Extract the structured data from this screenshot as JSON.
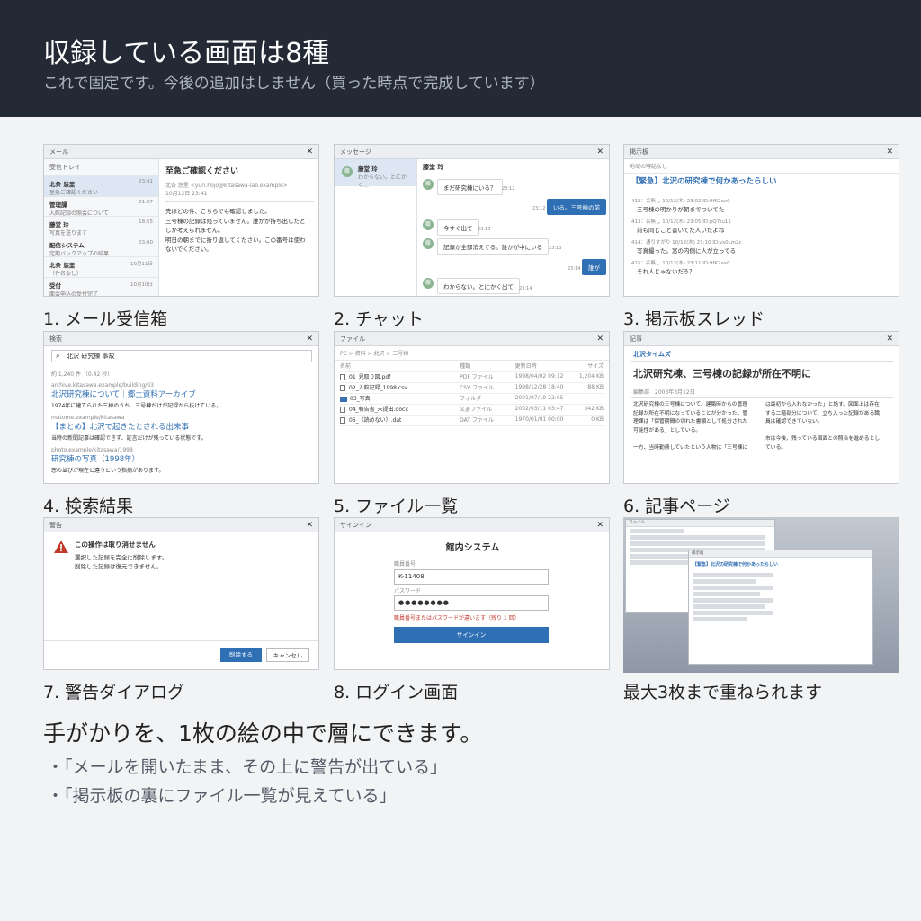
{
  "header": {
    "title": "収録している画面は8種",
    "subtitle": "これで固定です。今後の追加はしません（買った時点で完成しています）"
  },
  "captions": [
    "1. メール受信箱",
    "2. チャット",
    "3. 掲示板スレッド",
    "4. 検索結果",
    "5. ファイル一覧",
    "6. 記事ページ",
    "7. 警告ダイアログ",
    "8. ログイン画面",
    "最大3枚まで重ねられます"
  ],
  "mail": {
    "title": "メール",
    "folder": "受信トレイ",
    "items": [
      {
        "from": "北条 悠里",
        "subject": "至急ご確認ください",
        "time": "23:41"
      },
      {
        "from": "管理課",
        "subject": "入館記録の照会について",
        "time": "21:07"
      },
      {
        "from": "藤堂 玲",
        "subject": "写真を送ります",
        "time": "18:55"
      },
      {
        "from": "配信システム",
        "subject": "定期バックアップの結果",
        "time": "03:00"
      },
      {
        "from": "北条 悠里",
        "subject": "（件名なし）",
        "time": "10月11日"
      },
      {
        "from": "受付",
        "subject": "面会申込の受付完了",
        "time": "10月10日"
      }
    ],
    "open_subject": "至急ご確認ください",
    "open_from": "北条 悠里 <yuri.hojo@kitasawa-lab.example>",
    "open_date": "10月12日 23:41",
    "body": [
      "先ほどの件、こちらでも確認しました。",
      "三号棟の記録は残っていません。誰かが持ち出したと",
      "しか考えられません。",
      "明日の朝までに折り返してください。この番号は使わ",
      "ないでください。"
    ]
  },
  "chat": {
    "title": "メッセージ",
    "contact": "藤堂 玲",
    "preview": "わからない。とにかく…",
    "avatar": "藤",
    "messages": [
      {
        "text": "まだ研究棟にいる？",
        "time": "23:12"
      },
      {
        "text": "いる。三号棟の前",
        "time": "23:12"
      },
      {
        "text": "今すぐ出て",
        "time": "23:13"
      },
      {
        "text": "記録が全部消えてる。誰かが中にいる",
        "time": "23:13"
      },
      {
        "text": "誰が",
        "time": "23:14"
      },
      {
        "text": "わからない。とにかく出て",
        "time": "23:14"
      }
    ]
  },
  "board": {
    "title": "掲示板",
    "sub": "地域の噂話なし",
    "thread": "【緊急】北沢の研究棟で何かあったらしい",
    "posts": [
      {
        "meta": "412：名無し 10/12(木) 23:02 ID:9fK2ax0",
        "text": "三号棟の明かりが朝までついてた"
      },
      {
        "meta": "413：名無し 10/12(木) 23:05 ID:pQ7tu11",
        "text": "前も同じこと書いてた人いたよね"
      },
      {
        "meta": "414：通りすがり 10/12(木) 23:10 ID:vs0Lm2c",
        "text": "写真撮った。窓の内側に人が立ってる"
      },
      {
        "meta": "415：名無し 10/12(木) 23:11 ID:9fK2ax0",
        "text": "それ人じゃないだろ？"
      }
    ]
  },
  "search": {
    "title": "検索",
    "query": "北沢 研究棟 事故",
    "count": "約 1,240 件 （0.42 秒）",
    "results": [
      {
        "url": "archive.kitasawa.example/building/03",
        "title": "北沢研究棟について｜郷土資料アーカイブ",
        "snippet": "1974年に建てられた三棟のうち、三号棟だけが記録から抜けている。"
      },
      {
        "url": "matome.example/kitasawa",
        "title": "【まとめ】北沢で起きたとされる出来事",
        "snippet": "当時の新聞記事は確認できず、証言だけが残っている状態です。"
      },
      {
        "url": "photo.example/kitasawa/1998",
        "title": "研究棟の写真（1998年）",
        "snippet": "窓の並びが現在と違うという指摘があります。"
      }
    ]
  },
  "files": {
    "title": "ファイル",
    "path": "PC > 資料 > 北沢 > 三号棟",
    "cols": [
      "名前",
      "種類",
      "更新日時",
      "サイズ"
    ],
    "rows": [
      {
        "name": "01_見取り図.pdf",
        "type": "PDF ファイル",
        "date": "1998/04/02 09:12",
        "size": "1,204 KB",
        "folder": false
      },
      {
        "name": "02_入館記録_1998.csv",
        "type": "CSV ファイル",
        "date": "1998/12/28 18:40",
        "size": "88 KB",
        "folder": false
      },
      {
        "name": "03_写真",
        "type": "フォルダー",
        "date": "2001/07/19 22:05",
        "size": "",
        "folder": true
      },
      {
        "name": "04_報告書_未提出.docx",
        "type": "文書ファイル",
        "date": "2002/03/11 03:47",
        "size": "342 KB",
        "folder": false
      },
      {
        "name": "05_（読めない）.dat",
        "type": "DAT ファイル",
        "date": "1970/01/01 00:00",
        "size": "0 KB",
        "folder": false
      }
    ]
  },
  "article": {
    "title": "記事",
    "paper": "北沢タイムズ",
    "headline": "北沢研究棟、三号棟の記録が所在不明に",
    "byline": "編集部　2003年3月12日",
    "col1": [
      "北沢研究棟の三号棟について、建築時からの管理",
      "記録が所在不明になっていることが分かった。管",
      "理課は「保管期間の切れた書類として処分された",
      "可能性がある」としている。",
      "",
      "一方、当時勤務していたという人物は「三号棟に"
    ],
    "col2": [
      "は最初から入れなかった」と話す。図面上は存在",
      "する二階部分について、立ち入った記録がある職",
      "員は確認できていない。",
      "",
      "市は今後、残っている図面との照合を進めるとし",
      "ている。"
    ]
  },
  "alert": {
    "title": "警告",
    "heading": "この操作は取り消せません",
    "line1": "選択した記録を完全に削除します。",
    "line2": "削除した記録は復元できません。",
    "delete": "削除する",
    "cancel": "キャンセル"
  },
  "login": {
    "title": "サインイン",
    "system": "館内システム",
    "id_label": "職員番号",
    "id_value": "K-11408",
    "pw_label": "パスワード",
    "pw_value": "●●●●●●●●",
    "error": "職員番号またはパスワードが違います（残り 1 回）",
    "button": "サインイン"
  },
  "stack": {
    "back_title": "ファイル",
    "front_title": "掲示板",
    "front_thread": "【緊急】北沢の研究棟で何かあったらしい"
  },
  "bottom": {
    "heading": "手がかりを、1枚の絵の中で層にできます。",
    "bullets": [
      "・「メールを開いたまま、その上に警告が出ている」",
      "・「掲示板の裏にファイル一覧が見えている」"
    ]
  },
  "colors": {
    "header_bg": "#232a35",
    "accent": "#2f6fb3",
    "danger": "#c0392b"
  }
}
